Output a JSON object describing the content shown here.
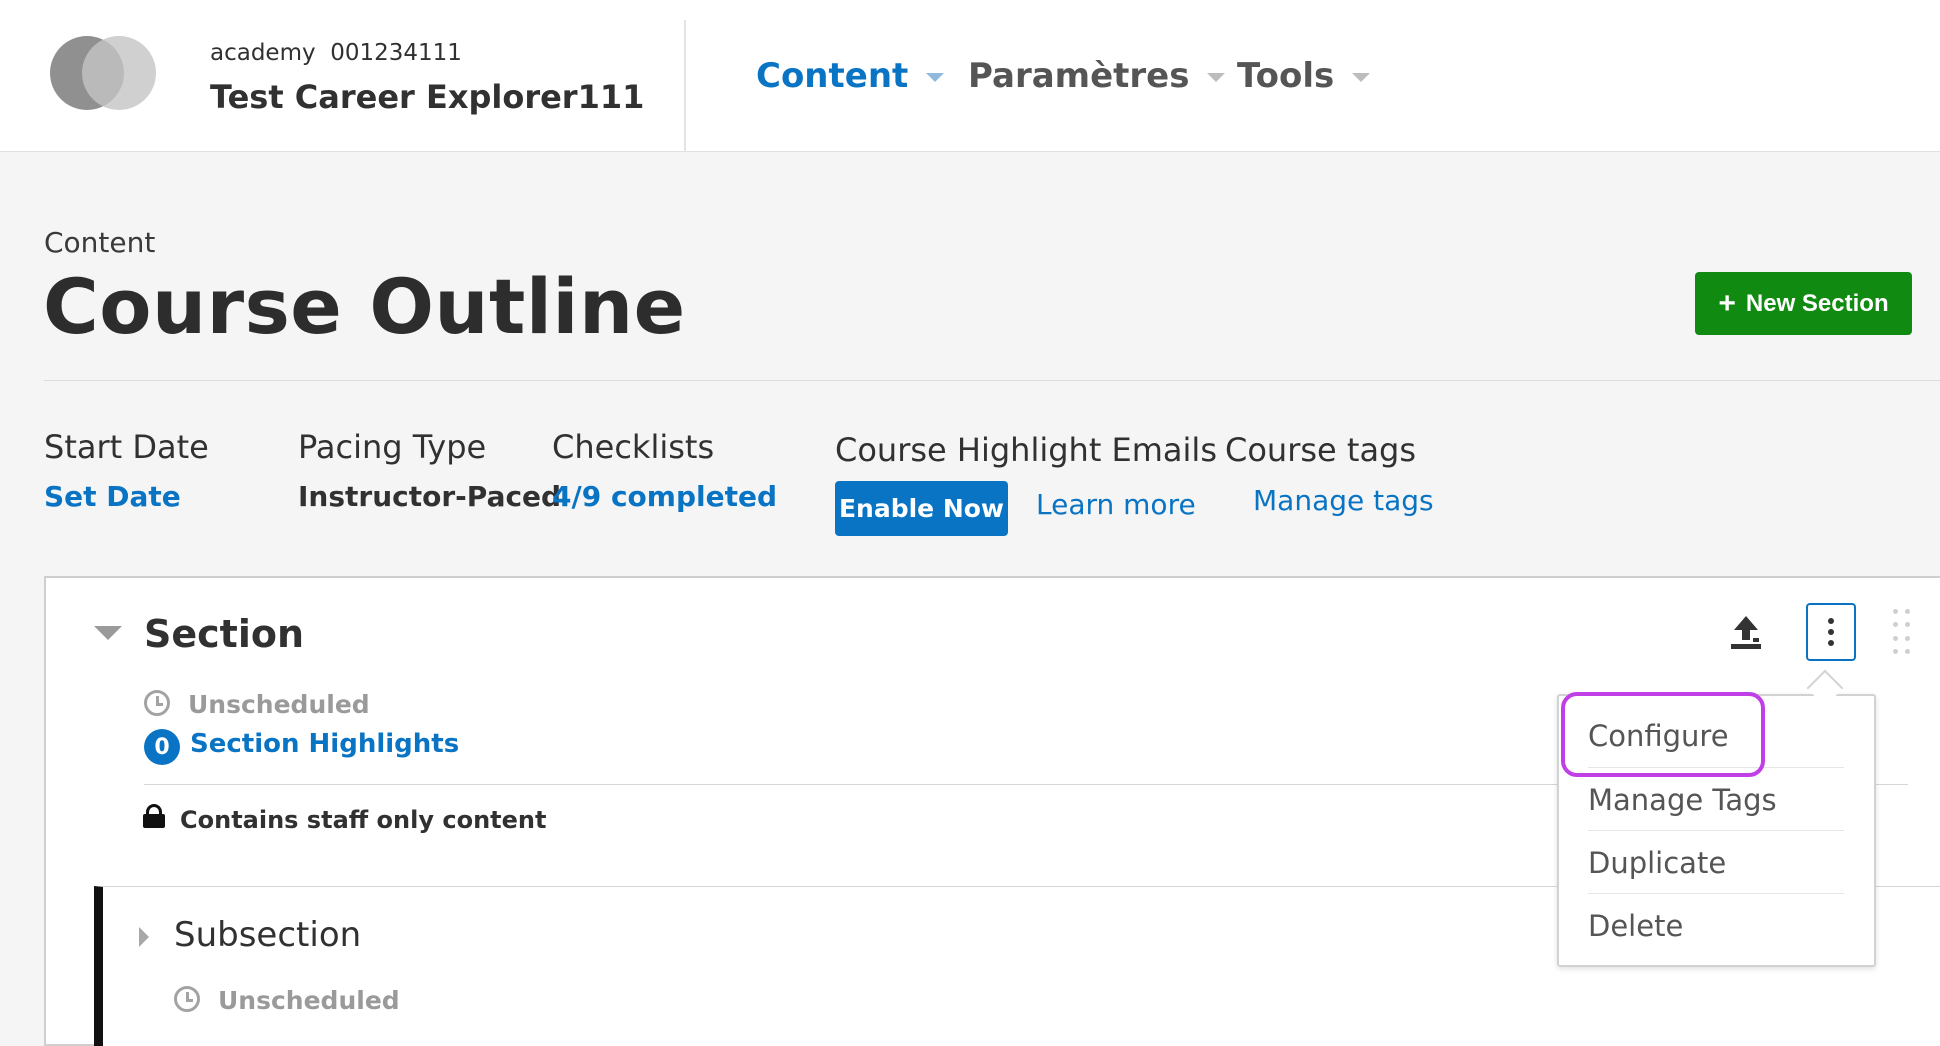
{
  "header": {
    "org_line": "academy  001234111",
    "course_title": "Test Career Explorer111",
    "nav": [
      {
        "label": "Content"
      },
      {
        "label": "Paramètres"
      },
      {
        "label": "Tools"
      }
    ]
  },
  "page": {
    "breadcrumb": "Content",
    "title": "Course Outline",
    "new_section_label": "New Section"
  },
  "settings": {
    "start_date": {
      "label": "Start Date",
      "link": "Set Date"
    },
    "pacing": {
      "label": "Pacing Type",
      "value": "Instructor-Paced"
    },
    "checklists": {
      "label": "Checklists",
      "link": "4/9 completed"
    },
    "highlight_emails": {
      "label": "Course Highlight Emails",
      "button": "Enable Now",
      "link": "Learn more"
    },
    "tags": {
      "label": "Course tags",
      "link": "Manage tags"
    }
  },
  "section": {
    "title": "Section",
    "status": "Unscheduled",
    "highlights_count": "0",
    "highlights_label": "Section Highlights",
    "staff_only_text": "Contains staff only content"
  },
  "subsection": {
    "title": "Subsection",
    "status": "Unscheduled"
  },
  "menu": {
    "items": [
      {
        "label": "Configure"
      },
      {
        "label": "Manage Tags"
      },
      {
        "label": "Duplicate"
      },
      {
        "label": "Delete"
      }
    ]
  },
  "colors": {
    "brand_blue": "#0a74c4",
    "new_section_green": "#118a11",
    "highlight_purple": "#c13fe6"
  }
}
